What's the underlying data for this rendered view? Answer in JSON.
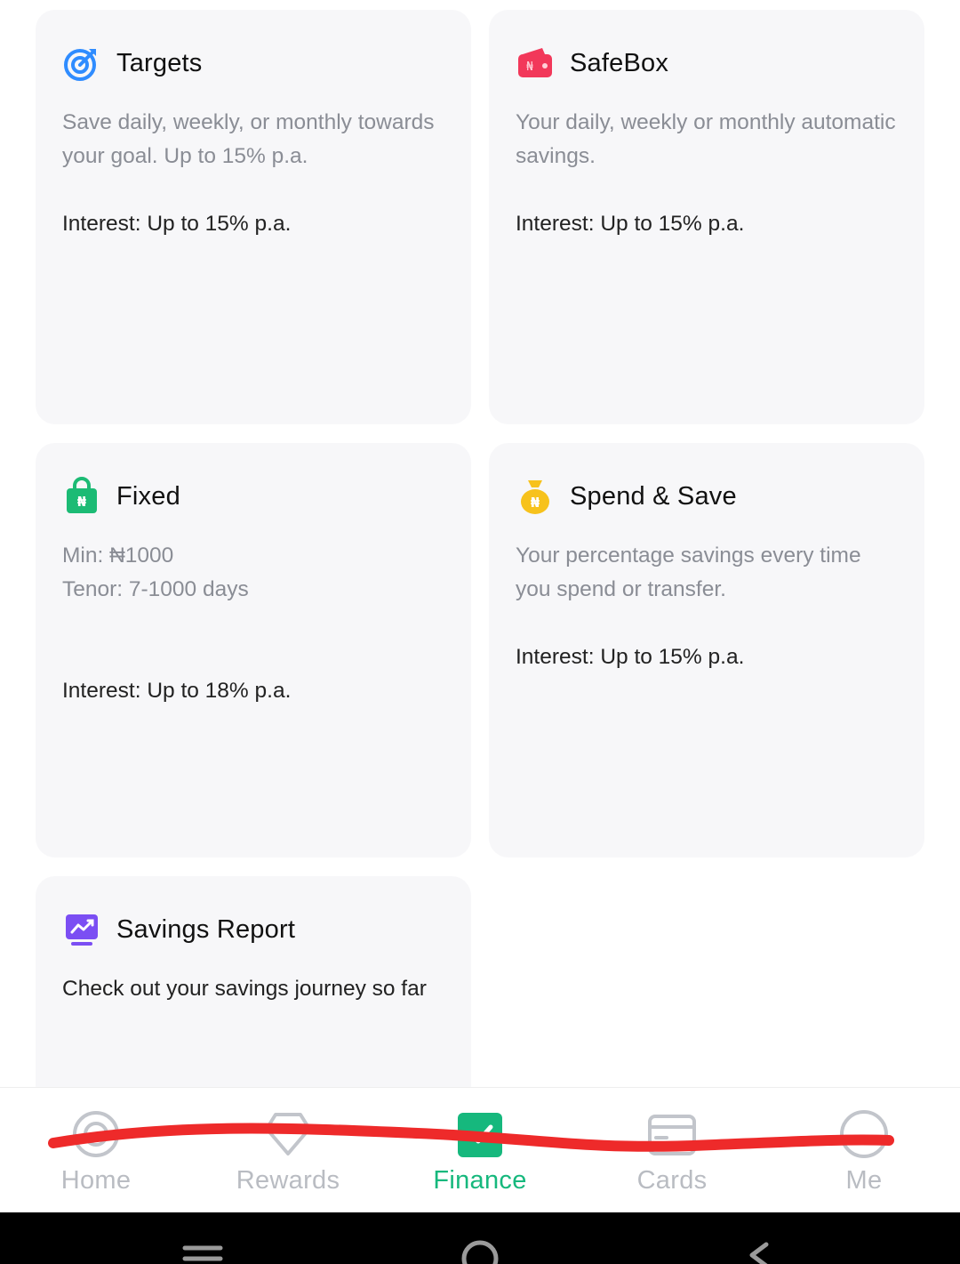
{
  "cards": {
    "targets": {
      "title": "Targets",
      "desc": "Save daily, weekly, or monthly towards your goal. Up to 15% p.a.",
      "interest": "Interest: Up to 15% p.a."
    },
    "safebox": {
      "title": "SafeBox",
      "desc": "Your daily, weekly or monthly automatic savings.",
      "interest": "Interest: Up to 15% p.a."
    },
    "fixed": {
      "title": "Fixed",
      "min": "Min: ₦1000",
      "tenor": "Tenor: 7-1000 days",
      "interest": "Interest: Up to 18% p.a."
    },
    "spend_save": {
      "title": "Spend & Save",
      "desc": "Your percentage savings every time you spend or transfer.",
      "interest": "Interest: Up to 15% p.a."
    },
    "savings_report": {
      "title": "Savings Report",
      "desc": "Check out your savings journey so far"
    }
  },
  "icons": {
    "targets": "target-icon",
    "safebox": "wallet-icon",
    "fixed": "lock-bag-icon",
    "spend_save": "money-bag-icon",
    "savings_report": "chart-monitor-icon",
    "currency_glyph": "₦"
  },
  "tabbar": {
    "active": "Finance",
    "items": [
      {
        "label": "Home",
        "icon": "home-icon"
      },
      {
        "label": "Rewards",
        "icon": "rewards-icon"
      },
      {
        "label": "Finance",
        "icon": "finance-icon"
      },
      {
        "label": "Cards",
        "icon": "card-icon"
      },
      {
        "label": "Me",
        "icon": "profile-icon"
      }
    ]
  },
  "colors": {
    "accent_green": "#16b87d",
    "inactive_gray": "#b9bcc2",
    "card_bg": "#f7f7f9",
    "targets_blue": "#2f8cff",
    "safebox_red": "#f2385a",
    "fixed_green": "#1cbb75",
    "spend_yellow": "#f7c21c",
    "report_purple": "#7b4ef3",
    "annotation_red": "#ee2a2a"
  }
}
